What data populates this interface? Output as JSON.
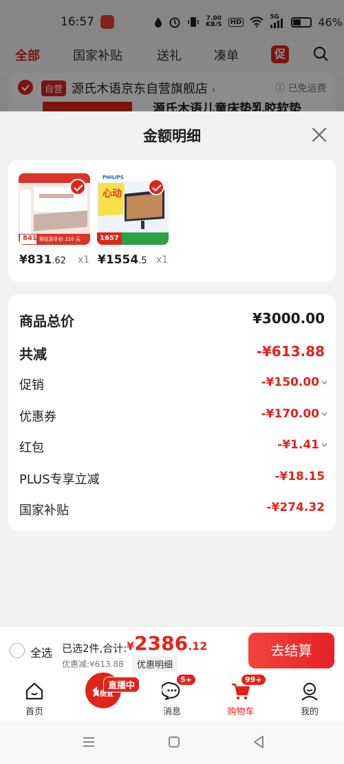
{
  "status_bar": {
    "time": "16:57",
    "speed_top": "7.00",
    "speed_unit": "KB/S",
    "hd": "HD",
    "network": "5G",
    "battery": "46%"
  },
  "top_nav": {
    "tabs": [
      {
        "label": "全部",
        "active": true
      },
      {
        "label": "国家补贴"
      },
      {
        "label": "送礼"
      },
      {
        "label": "凑单"
      }
    ],
    "promo_label": "促"
  },
  "shop": {
    "self_tag": "自营",
    "name": "源氏木语京东自营旗舰店",
    "arrow": "›",
    "shipping": "已免运费"
  },
  "peek_text": "源氏木语儿童床垫乳胶软垫",
  "sheet": {
    "title": "金额明细",
    "products": [
      {
        "price_int": "¥831",
        "price_dec": ".62",
        "qty": "x1",
        "thumb_price": "841",
        "thumb_promo": "预估到手价 210 元"
      },
      {
        "price_int": "¥1554",
        "price_dec": ".5",
        "qty": "x1",
        "thumb_price": "1657",
        "thumb_brand": "PHILIPS"
      }
    ],
    "rows": [
      {
        "label": "商品总价",
        "value": "¥3000.00",
        "big": true,
        "color": "black"
      },
      {
        "label": "共减",
        "value": "-¥613.88",
        "big": true
      },
      {
        "label": "促销",
        "value": "-¥150.00",
        "chevron": true
      },
      {
        "label": "优惠券",
        "value": "-¥170.00",
        "chevron": true
      },
      {
        "label": "红包",
        "value": "-¥1.41",
        "chevron": true
      },
      {
        "label": "PLUS专享立减",
        "value": "-¥18.15"
      },
      {
        "label": "国家补贴",
        "value": "-¥274.32"
      }
    ]
  },
  "checkout": {
    "select_all": "全选",
    "selected_summary": "已选2件,合计:",
    "total_yen": "¥",
    "total_int": "2386",
    "total_dec": ".12",
    "saved": "优惠减:¥613.88",
    "detail_link": "优惠明细",
    "pay_button": "去结算"
  },
  "tab_bar": {
    "home": "首页",
    "live_badge": "直播中",
    "live_label": "真便宜",
    "messages": "消息",
    "messages_badge": "5+",
    "cart": "购物车",
    "cart_badge": "99+",
    "me": "我的"
  },
  "colors": {
    "accent": "#e2231a",
    "background": "#f2f2f2"
  }
}
